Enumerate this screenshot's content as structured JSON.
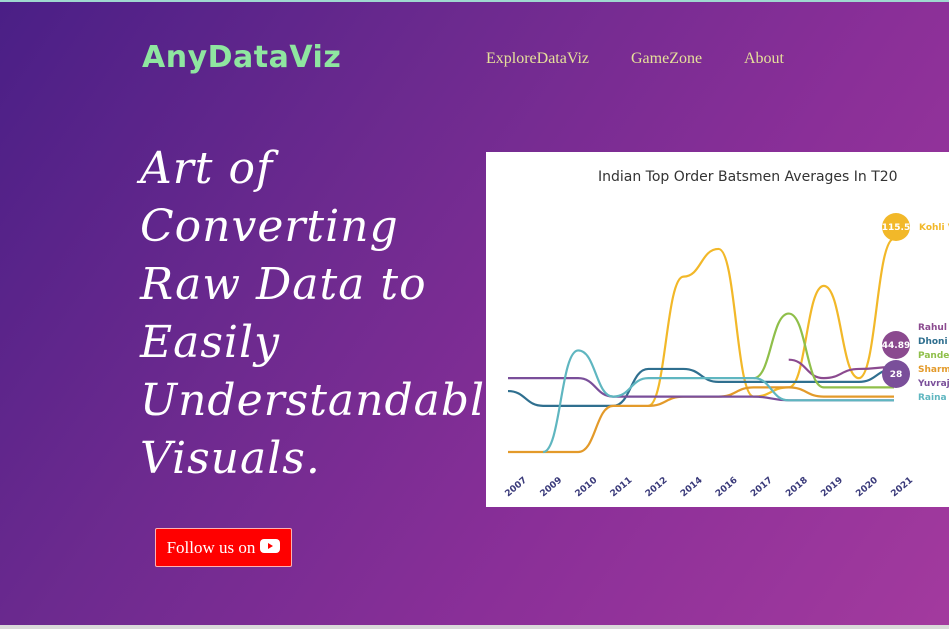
{
  "header": {
    "logo": "AnyDataViz",
    "nav": [
      "ExploreDataViz",
      "GameZone",
      "About"
    ]
  },
  "hero": {
    "headline": "Art of\nConverting\nRaw Data to\nEasily\nUnderstandable\nVisuals."
  },
  "follow_button": {
    "label": "Follow us on",
    "icon": "youtube-icon"
  },
  "colors": {
    "logo": "#8fe6a0",
    "nav": "#e6e09a",
    "follow_bg": "#ff0000",
    "kohli": "#f2b829",
    "rahul": "#8b4a8f",
    "dhoni": "#2f6f8f",
    "pandey": "#8fbf4a",
    "sharma": "#e39a2a",
    "yuvraj": "#7a4f9a",
    "raina": "#5fb6c0"
  },
  "chart_data": {
    "type": "line",
    "title": "Indian Top Order Batsmen Averages In T20",
    "x": [
      "2007",
      "2009",
      "2010",
      "2011",
      "2012",
      "2014",
      "2016",
      "2017",
      "2018",
      "2019",
      "2020",
      "2021"
    ],
    "series": [
      {
        "name": "Kohli V",
        "values": [
          null,
          null,
          null,
          null,
          25,
          95,
          110,
          30,
          35,
          90,
          40,
          115.5
        ]
      },
      {
        "name": "Rahul",
        "values": [
          null,
          null,
          null,
          null,
          null,
          null,
          null,
          null,
          50,
          40,
          45,
          46
        ]
      },
      {
        "name": "Dhoni",
        "values": [
          33,
          25,
          25,
          25,
          45,
          45,
          38,
          38,
          38,
          38,
          38,
          44.89
        ]
      },
      {
        "name": "Pandey",
        "values": [
          null,
          null,
          null,
          null,
          null,
          null,
          null,
          40,
          75,
          35,
          35,
          35
        ]
      },
      {
        "name": "Sharma",
        "values": [
          0,
          0,
          0,
          25,
          25,
          30,
          30,
          35,
          35,
          30,
          30,
          30
        ]
      },
      {
        "name": "Yuvraj",
        "values": [
          40,
          40,
          40,
          30,
          30,
          30,
          30,
          30,
          28,
          28,
          28,
          28
        ]
      },
      {
        "name": "Raina",
        "values": [
          null,
          0,
          55,
          30,
          40,
          40,
          40,
          40,
          28,
          28,
          28,
          28
        ]
      }
    ],
    "labels": {
      "kohli_value": "115.5",
      "dhoni_value": "44.89",
      "raina_value": "28"
    },
    "ylim": [
      0,
      130
    ]
  }
}
